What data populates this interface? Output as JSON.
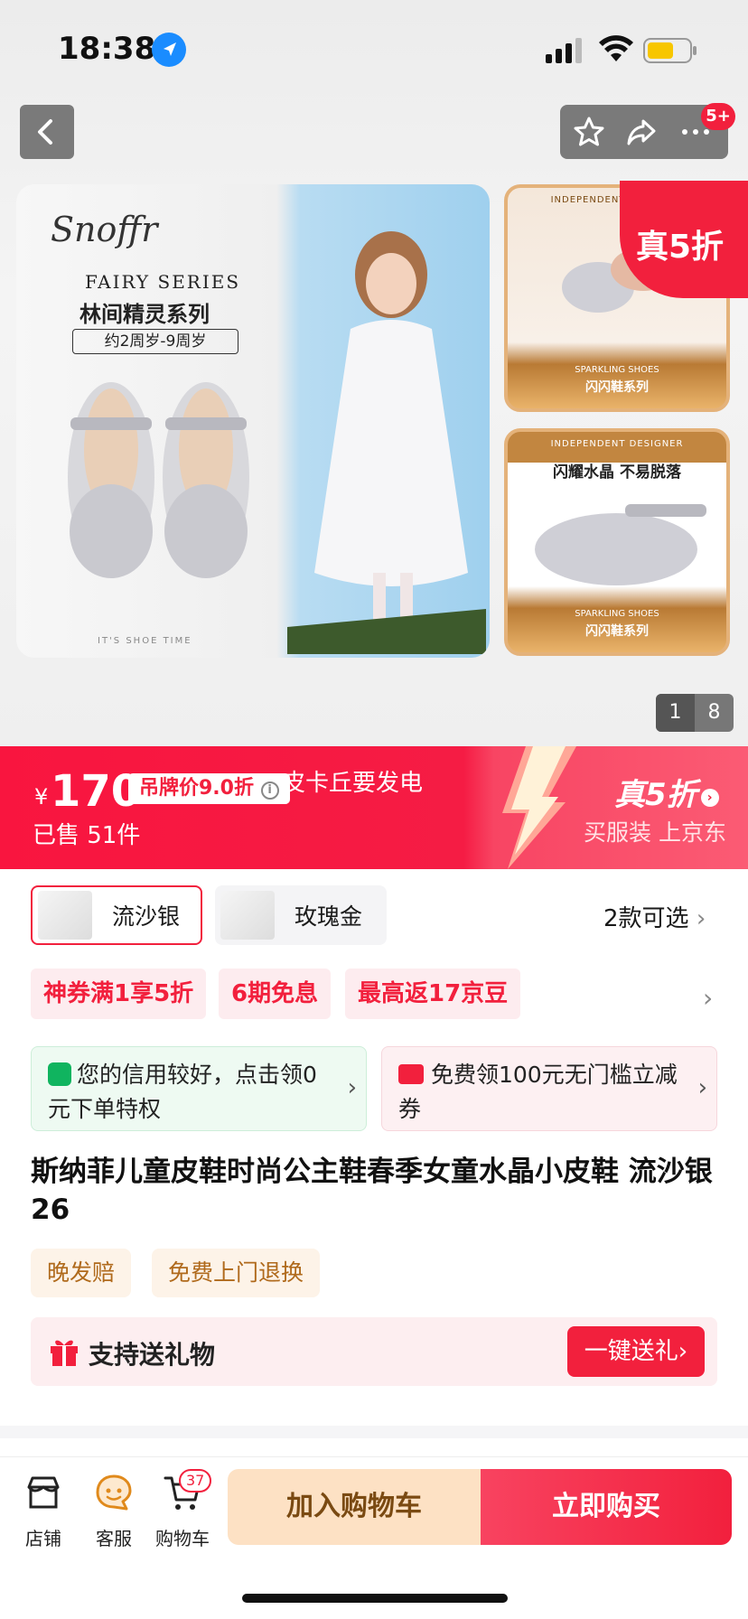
{
  "status": {
    "time": "18:38"
  },
  "header": {
    "notification_badge": "5+"
  },
  "gallery": {
    "brand": "Snoffr",
    "series_en": "FAIRY SERIES",
    "series_cn": "林间精灵系列",
    "age_range": "约2周岁-9周岁",
    "footer": "IT'S SHOE TIME",
    "designer_label": "INDEPENDENT DESIGNER",
    "sparkling_en": "SPARKLING SHOES",
    "sparkling_cn": "闪闪鞋系列",
    "crystal_headline": "闪耀水晶 不易脱落",
    "promo_badge": "真5折",
    "page_current": "1",
    "page_total": "8"
  },
  "price_banner": {
    "currency": "¥",
    "price": "170",
    "tag_price": "吊牌价9.0折",
    "banner_text": "皮卡丘要发电",
    "sold": "已售 51件",
    "real_discount": "真5折",
    "slogan": "买服装 上京东"
  },
  "variants": {
    "items": [
      {
        "label": "流沙银",
        "selected": true
      },
      {
        "label": "玫瑰金",
        "selected": false
      }
    ],
    "count_text": "2款可选"
  },
  "promos": [
    "神券满1享5折",
    "6期免息",
    "最高返17京豆"
  ],
  "info_cards": [
    {
      "text": "您的信用较好，点击领0元下单特权"
    },
    {
      "text": "免费领100元无门槛立减券"
    }
  ],
  "product": {
    "title": "斯纳菲儿童皮鞋时尚公主鞋春季女童水晶小皮鞋 流沙银 26",
    "service_chips": [
      "晚发赔",
      "免费上门退换"
    ]
  },
  "gift": {
    "label": "支持送礼物",
    "button": "一键送礼"
  },
  "bottom_nav": {
    "items": [
      {
        "label": "店铺",
        "icon": "store-icon"
      },
      {
        "label": "客服",
        "icon": "customer-service-icon"
      },
      {
        "label": "购物车",
        "icon": "cart-icon"
      }
    ],
    "cart_count": "37",
    "add_to_cart": "加入购物车",
    "buy_now": "立即购买"
  },
  "colors": {
    "accent": "#f2203d",
    "add_cart_bg": "#fde1c4",
    "add_cart_text": "#7a4a12"
  }
}
